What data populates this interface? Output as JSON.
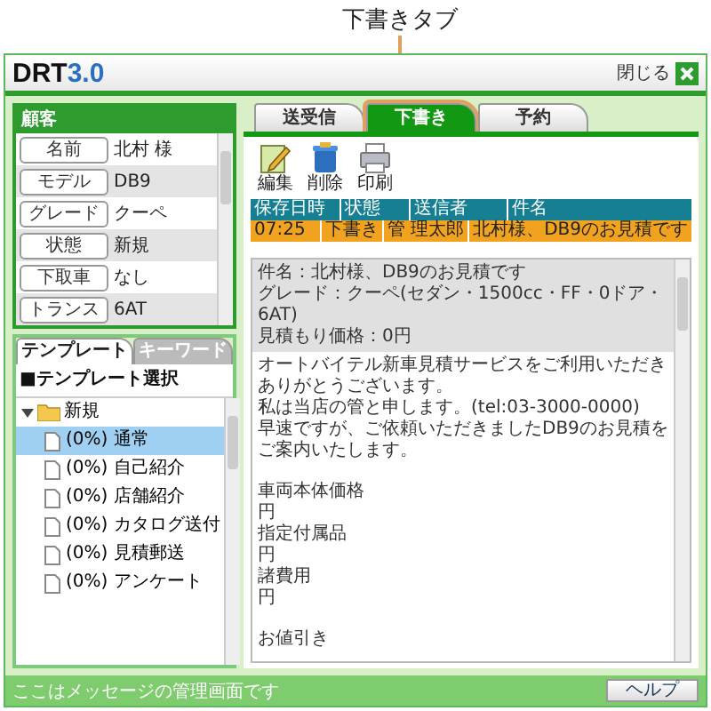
{
  "annotation": {
    "label": "下書きタブ"
  },
  "window": {
    "logo_prefix": "DRT",
    "logo_version": "3.0",
    "close_label": "閉じる"
  },
  "customer": {
    "title": "顧客",
    "fields": [
      {
        "label": "名前",
        "value": "北村 様"
      },
      {
        "label": "モデル",
        "value": "DB9"
      },
      {
        "label": "グレード",
        "value": "クーペ"
      },
      {
        "label": "状態",
        "value": "新規"
      },
      {
        "label": "下取車",
        "value": "なし"
      },
      {
        "label": "トランス",
        "value": "6AT"
      }
    ]
  },
  "template_tabs": [
    {
      "label": "テンプレート",
      "selected": true
    },
    {
      "label": "キーワード",
      "selected": false
    }
  ],
  "template_heading": "■テンプレート選択",
  "tree": [
    {
      "label": "新規",
      "expanded": true,
      "children": [
        {
          "label": "(0%) 通常",
          "selected": true
        },
        {
          "label": "(0%) 自己紹介",
          "selected": false
        },
        {
          "label": "(0%) 店舗紹介",
          "selected": false
        },
        {
          "label": "(0%) カタログ送付",
          "selected": false
        },
        {
          "label": "(0%) 見積郵送",
          "selected": false
        },
        {
          "label": "(0%) アンケート",
          "selected": false
        }
      ]
    }
  ],
  "main_tabs": [
    {
      "label": "送受信",
      "selected": false
    },
    {
      "label": "下書き",
      "selected": true
    },
    {
      "label": "予約",
      "selected": false
    }
  ],
  "toolbar": [
    {
      "kind": "edit",
      "label": "編集"
    },
    {
      "kind": "delete",
      "label": "削除"
    },
    {
      "kind": "print",
      "label": "印刷"
    }
  ],
  "table": {
    "columns": [
      "保存日時",
      "状態",
      "送信者",
      "件名"
    ],
    "rows": [
      {
        "cells": [
          "07:25",
          "下書き",
          "管 理太郎",
          "北村様、DB9のお見積です"
        ],
        "selected": true
      }
    ]
  },
  "preview": {
    "header_lines": [
      "件名：北村様、DB9のお見積です",
      "グレード：クーペ(セダン・1500cc・FF・0ドア・6AT)",
      "見積もり価格：0円"
    ],
    "body_blocks": [
      [
        "オートバイテル新車見積サービスをご利用いただきありがとうございます。",
        "私は当店の管と申します。(tel:03-3000-0000)",
        "早速ですが、ご依頼いただきましたDB9のお見積をご案内いたします。"
      ],
      [
        "車両本体価格",
        "円",
        "指定付属品",
        "円",
        "諸費用",
        "円"
      ],
      [
        "お値引き"
      ]
    ]
  },
  "status_bar": {
    "message": "ここはメッセージの管理画面です",
    "help_button": "ヘルプ"
  }
}
